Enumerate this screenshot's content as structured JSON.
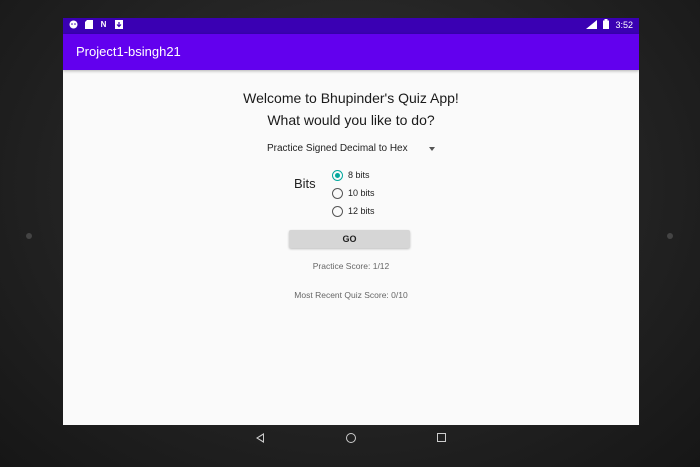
{
  "status_bar": {
    "time": "3:52",
    "left_icons": [
      "android-icon",
      "sd-card-icon",
      "n-icon",
      "download-icon"
    ],
    "right_icons": [
      "lte-signal-icon",
      "battery-icon"
    ]
  },
  "app_bar": {
    "title": "Project1-bsingh21"
  },
  "main": {
    "welcome": "Welcome to Bhupinder's Quiz App!",
    "question": "What would you like to do?",
    "mode_select": {
      "selected": "Practice Signed Decimal to Hex"
    },
    "bits_label": "Bits",
    "bits_options": [
      {
        "label": "8 bits",
        "checked": true
      },
      {
        "label": "10 bits",
        "checked": false
      },
      {
        "label": "12 bits",
        "checked": false
      }
    ],
    "go_label": "GO",
    "practice_score": "Practice Score: 1/12",
    "quiz_score": "Most Recent Quiz Score: 0/10"
  },
  "colors": {
    "status_bar": "#3a00b3",
    "app_bar": "#6200ee",
    "radio_accent": "#03a89e",
    "background": "#fafafa"
  }
}
